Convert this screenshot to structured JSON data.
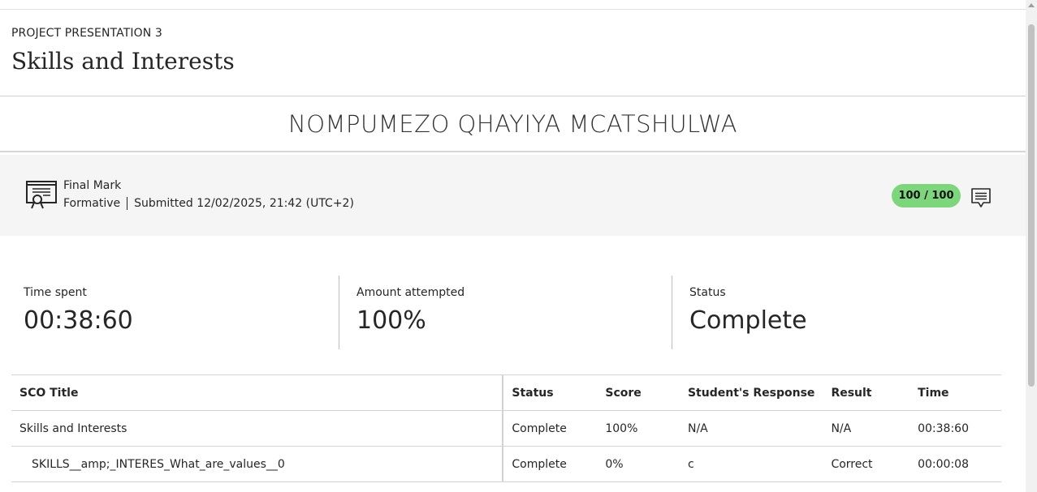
{
  "header": {
    "breadcrumb": "PROJECT PRESENTATION 3",
    "title": "Skills and Interests"
  },
  "student": {
    "name": "NOMPUMEZO QHAYIYA MCATSHULWA"
  },
  "grade": {
    "label": "Final Mark",
    "type": "Formative",
    "submitted": "Submitted 12/02/2025, 21:42 (UTC+2)",
    "score": "100 / 100",
    "icon": "certificate-icon",
    "feedback_icon": "feedback-comment-icon",
    "badge_color": "#7ed67c"
  },
  "stats": [
    {
      "label": "Time spent",
      "value": "00:38:60"
    },
    {
      "label": "Amount attempted",
      "value": "100%"
    },
    {
      "label": "Status",
      "value": "Complete"
    }
  ],
  "table": {
    "headers": [
      "SCO Title",
      "Status",
      "Score",
      "Student's Response",
      "Result",
      "Time"
    ],
    "rows": [
      [
        "Skills and Interests",
        "Complete",
        "100%",
        "N/A",
        "N/A",
        "00:38:60"
      ],
      [
        "SKILLS__amp;_INTERES_What_are_values__0",
        "Complete",
        "0%",
        "c",
        "Correct",
        "00:00:08"
      ]
    ]
  }
}
